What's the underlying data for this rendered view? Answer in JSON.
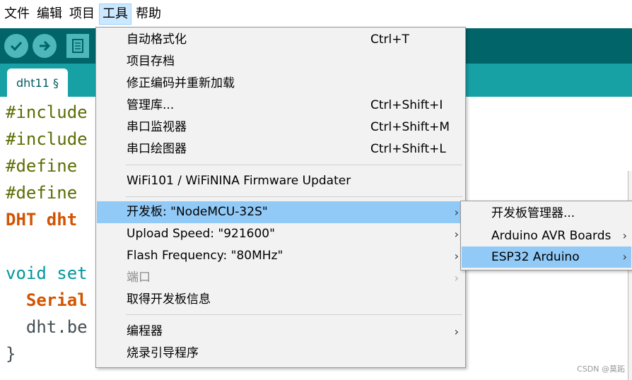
{
  "menubar": {
    "items": [
      {
        "label": "文件"
      },
      {
        "label": "编辑"
      },
      {
        "label": "项目"
      },
      {
        "label": "工具",
        "active": true
      },
      {
        "label": "帮助"
      }
    ]
  },
  "tab": {
    "label": "dht11 §"
  },
  "code": [
    "#include",
    "#include",
    "#define ",
    "#define ",
    "DHT dht",
    "",
    "void set",
    "  Serial",
    "  dht.be",
    "}"
  ],
  "tools_menu": {
    "items": [
      {
        "label": "自动格式化",
        "shortcut": "Ctrl+T"
      },
      {
        "label": "项目存档",
        "shortcut": ""
      },
      {
        "label": "修正编码并重新加载",
        "shortcut": ""
      },
      {
        "label": "管理库...",
        "shortcut": "Ctrl+Shift+I"
      },
      {
        "label": "串口监视器",
        "shortcut": "Ctrl+Shift+M"
      },
      {
        "label": "串口绘图器",
        "shortcut": "Ctrl+Shift+L"
      },
      {
        "label": "WiFi101 / WiFiNINA Firmware Updater",
        "shortcut": ""
      },
      {
        "label": "开发板: \"NodeMCU-32S\"",
        "arrow": "›"
      },
      {
        "label": "Upload Speed: \"921600\"",
        "arrow": "›"
      },
      {
        "label": "Flash Frequency: \"80MHz\"",
        "arrow": "›"
      },
      {
        "label": "端口",
        "arrow": "›"
      },
      {
        "label": "取得开发板信息",
        "shortcut": ""
      },
      {
        "label": "编程器",
        "arrow": "›"
      },
      {
        "label": "烧录引导程序",
        "shortcut": ""
      }
    ]
  },
  "board_submenu": {
    "items": [
      {
        "label": "开发板管理器..."
      },
      {
        "label": "Arduino AVR Boards",
        "arrow": "›"
      },
      {
        "label": "ESP32 Arduino",
        "arrow": "›"
      }
    ]
  },
  "watermark": "CSDN @莫跖",
  "colors": {
    "toolbar": "#006468",
    "tabstrip": "#17a1a5",
    "highlight": "#91c9f7",
    "menu_bg": "#f2f2f2"
  }
}
